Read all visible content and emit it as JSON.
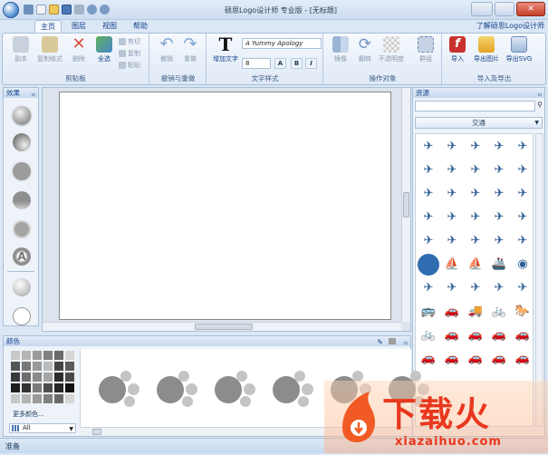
{
  "window": {
    "title": "硕思Logo设计师 专业版 - [无标题]"
  },
  "tabs": [
    "主页",
    "图层",
    "视图",
    "帮助"
  ],
  "help_link": "了解硕思Logo设计师",
  "ribbon": {
    "clipboard": {
      "label": "剪贴板",
      "buttons": [
        "副本",
        "复制格式",
        "删除",
        "全选"
      ],
      "small": [
        "剪切",
        "复制",
        "粘贴"
      ]
    },
    "undo": {
      "label": "撤销与重做",
      "buttons": [
        "撤销",
        "重做"
      ]
    },
    "text": {
      "label": "文字样式",
      "add_text": "增加文字",
      "font": "A Yummy Apology",
      "size": "8"
    },
    "ops": {
      "label": "操作对象",
      "buttons": [
        "镜像",
        "翻转",
        "不透明度",
        "群组"
      ]
    },
    "io": {
      "label": "导入及导出",
      "buttons": [
        "导入",
        "导出图片",
        "导出SVG"
      ]
    }
  },
  "effects": {
    "title": "效果"
  },
  "resources": {
    "title": "资源",
    "category": "交通"
  },
  "colors": {
    "title": "颜色",
    "more": "更多颜色...",
    "filter": "All"
  },
  "status": "准备",
  "watermark": {
    "brand": "下载火",
    "url": "xiazaihuo.com"
  }
}
